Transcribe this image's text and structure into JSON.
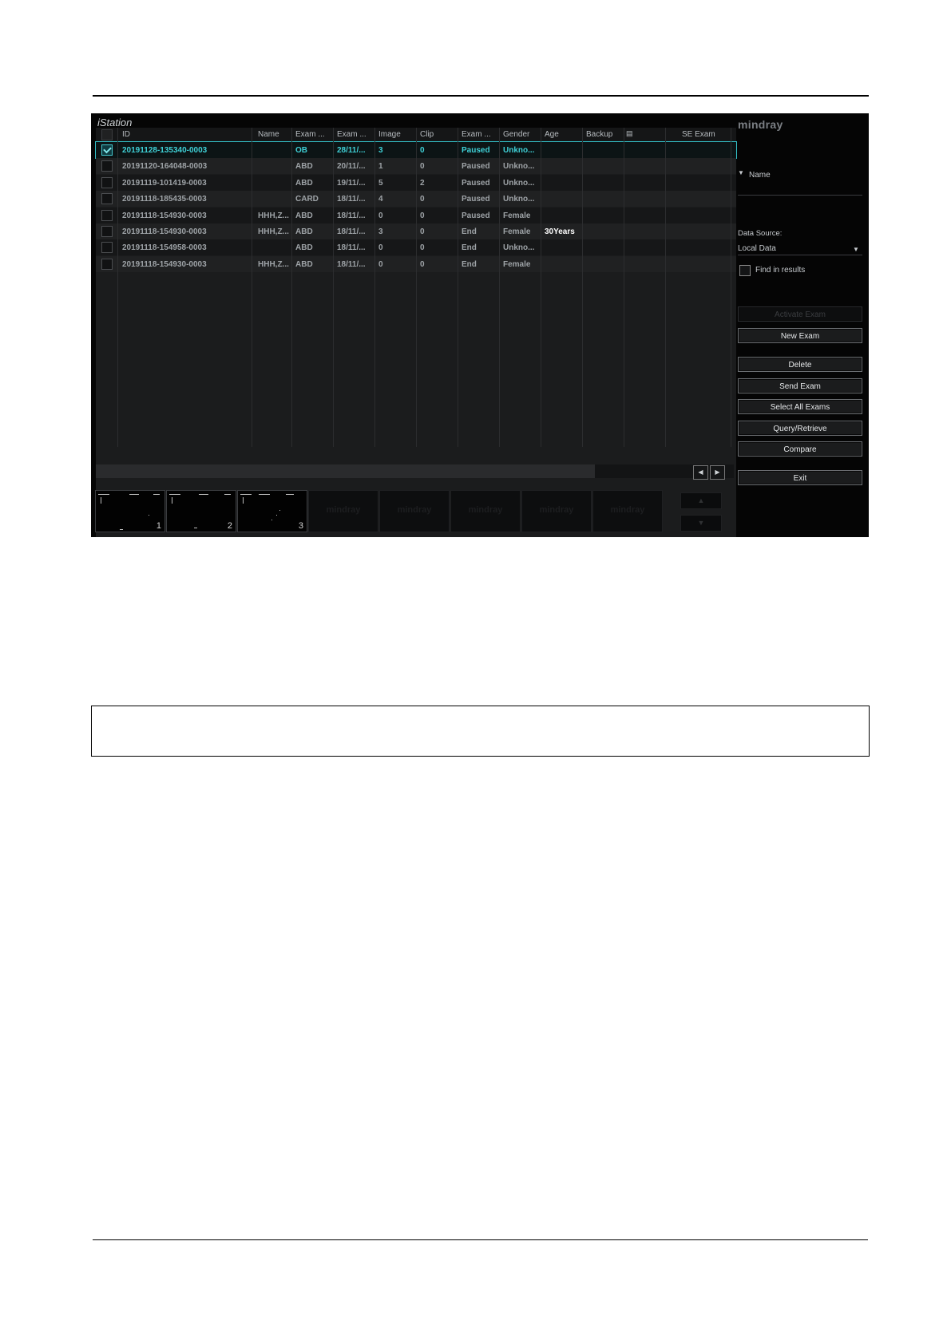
{
  "app": {
    "title": "iStation",
    "logo": "mindray"
  },
  "table": {
    "headers": [
      "ID",
      "Name",
      "Exam ...",
      "Exam ...",
      "Image",
      "Clip",
      "Exam ...",
      "Gender",
      "Age",
      "Backup",
      "SE Exam"
    ],
    "rows": [
      {
        "checked": true,
        "id": "20191128-135340-0003",
        "name": "",
        "exam_type": "OB",
        "exam_date": "28/11/...",
        "image": "3",
        "clip": "0",
        "status": "Paused",
        "gender": "Unkno...",
        "age": ""
      },
      {
        "checked": false,
        "id": "20191120-164048-0003",
        "name": "",
        "exam_type": "ABD",
        "exam_date": "20/11/...",
        "image": "1",
        "clip": "0",
        "status": "Paused",
        "gender": "Unkno...",
        "age": ""
      },
      {
        "checked": false,
        "id": "20191119-101419-0003",
        "name": "",
        "exam_type": "ABD",
        "exam_date": "19/11/...",
        "image": "5",
        "clip": "2",
        "status": "Paused",
        "gender": "Unkno...",
        "age": ""
      },
      {
        "checked": false,
        "id": "20191118-185435-0003",
        "name": "",
        "exam_type": "CARD",
        "exam_date": "18/11/...",
        "image": "4",
        "clip": "0",
        "status": "Paused",
        "gender": "Unkno...",
        "age": ""
      },
      {
        "checked": false,
        "id": "20191118-154930-0003",
        "name": "HHH,Z...",
        "exam_type": "ABD",
        "exam_date": "18/11/...",
        "image": "0",
        "clip": "0",
        "status": "Paused",
        "gender": "Female",
        "age": ""
      },
      {
        "checked": false,
        "id": "20191118-154930-0003",
        "name": "HHH,Z...",
        "exam_type": "ABD",
        "exam_date": "18/11/...",
        "image": "3",
        "clip": "0",
        "status": "End",
        "gender": "Female",
        "age": "30Years"
      },
      {
        "checked": false,
        "id": "20191118-154958-0003",
        "name": "",
        "exam_type": "ABD",
        "exam_date": "18/11/...",
        "image": "0",
        "clip": "0",
        "status": "End",
        "gender": "Unkno...",
        "age": ""
      },
      {
        "checked": false,
        "id": "20191118-154930-0003",
        "name": "HHH,Z...",
        "exam_type": "ABD",
        "exam_date": "18/11/...",
        "image": "0",
        "clip": "0",
        "status": "End",
        "gender": "Female",
        "age": ""
      }
    ]
  },
  "thumbnails": {
    "numbered": [
      "1",
      "2",
      "3"
    ],
    "empty_watermark": "mindray"
  },
  "panel": {
    "name_label": "Name",
    "data_source_label": "Data Source:",
    "data_source_value": "Local Data",
    "find_in_results": "Find in results",
    "buttons": {
      "activate": "Activate Exam",
      "new": "New Exam",
      "delete": "Delete",
      "send": "Send Exam",
      "select_all": "Select All Exams",
      "query": "Query/Retrieve",
      "compare": "Compare",
      "exit": "Exit"
    }
  },
  "colors": {
    "selection": "#33c2c9",
    "background": "#050505"
  }
}
